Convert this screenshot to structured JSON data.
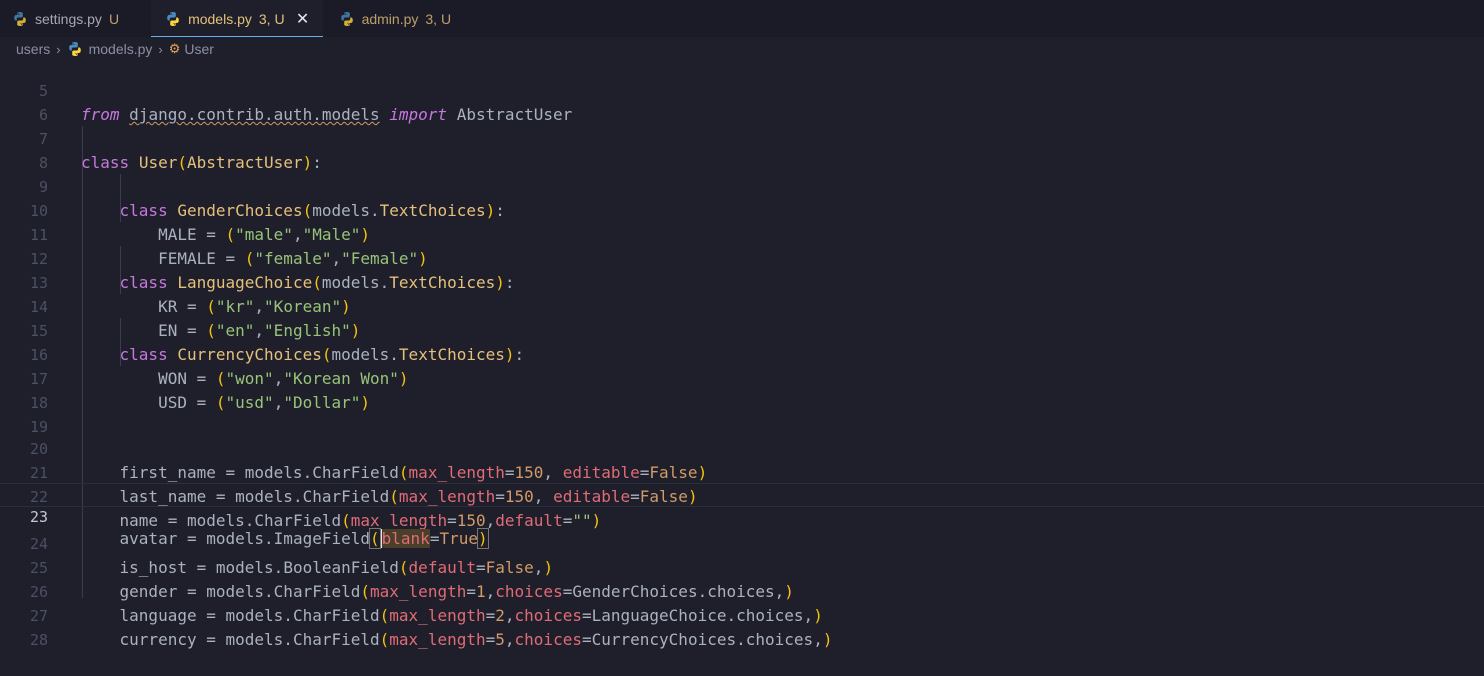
{
  "tabs": [
    {
      "label": "settings.py",
      "status": "U",
      "active": false
    },
    {
      "label": "models.py",
      "status": "3, U",
      "active": true
    },
    {
      "label": "admin.py",
      "status": "3, U",
      "active": false
    }
  ],
  "breadcrumb": {
    "folder": "users",
    "file": "models.py",
    "symbol": "User"
  },
  "line_numbers": [
    "5",
    "6",
    "7",
    "8",
    "9",
    "10",
    "11",
    "12",
    "13",
    "14",
    "15",
    "16",
    "17",
    "18",
    "19",
    "20",
    "21",
    "22",
    "23",
    "24",
    "25",
    "26",
    "27",
    "28"
  ],
  "code": {
    "l5": {
      "from": "from",
      "module": "django.contrib.auth.models",
      "import": "import",
      "name": "AbstractUser"
    },
    "l7": {
      "kw": "class",
      "name": "User",
      "base": "AbstractUser"
    },
    "l9": {
      "kw": "class",
      "name": "GenderChoices",
      "base_mod": "models",
      "base_cls": "TextChoices"
    },
    "l10": {
      "var": "MALE",
      "v1": "\"male\"",
      "v2": "\"Male\""
    },
    "l11": {
      "var": "FEMALE",
      "v1": "\"female\"",
      "v2": "\"Female\""
    },
    "l12": {
      "kw": "class",
      "name": "LanguageChoice",
      "base_mod": "models",
      "base_cls": "TextChoices"
    },
    "l13": {
      "var": "KR",
      "v1": "\"kr\"",
      "v2": "\"Korean\""
    },
    "l14": {
      "var": "EN",
      "v1": "\"en\"",
      "v2": "\"English\""
    },
    "l15": {
      "kw": "class",
      "name": "CurrencyChoices",
      "base_mod": "models",
      "base_cls": "TextChoices"
    },
    "l16": {
      "var": "WON",
      "v1": "\"won\"",
      "v2": "\"Korean Won\""
    },
    "l17": {
      "var": "USD",
      "v1": "\"usd\"",
      "v2": "\"Dollar\""
    },
    "l20": {
      "var": "first_name",
      "mod": "models",
      "field": "CharField",
      "p1": "max_length",
      "n1": "150",
      "p2": "editable",
      "b2": "False"
    },
    "l21": {
      "var": "last_name",
      "mod": "models",
      "field": "CharField",
      "p1": "max_length",
      "n1": "150",
      "p2": "editable",
      "b2": "False"
    },
    "l22": {
      "var": "name",
      "mod": "models",
      "field": "CharField",
      "p1": "max_length",
      "n1": "150",
      "p2": "default",
      "s2": "\"\""
    },
    "l23": {
      "var": "avatar",
      "mod": "models",
      "field": "ImageField",
      "p1a": "b",
      "p1b": "lank",
      "b1": "True"
    },
    "l24": {
      "var": "is_host",
      "mod": "models",
      "field": "BooleanField",
      "p1": "default",
      "b1": "False"
    },
    "l25": {
      "var": "gender",
      "mod": "models",
      "field": "CharField",
      "p1": "max_length",
      "n1": "1",
      "p2": "choices",
      "ref": "GenderChoices",
      "attr": "choices"
    },
    "l26": {
      "var": "language",
      "mod": "models",
      "field": "CharField",
      "p1": "max_length",
      "n1": "2",
      "p2": "choices",
      "ref": "LanguageChoice",
      "attr": "choices"
    },
    "l27": {
      "var": "currency",
      "mod": "models",
      "field": "CharField",
      "p1": "max_length",
      "n1": "5",
      "p2": "choices",
      "ref": "CurrencyChoices",
      "attr": "choices"
    }
  },
  "colors": {
    "background": "#1e1f2b",
    "keyword": "#c678dd",
    "class": "#e5c07b",
    "string": "#98c379",
    "param": "#e06c75",
    "number": "#d19a66"
  }
}
